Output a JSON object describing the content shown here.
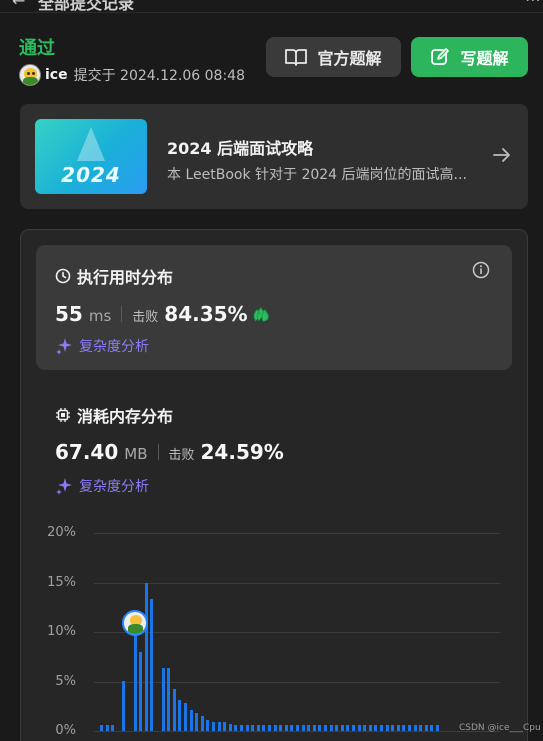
{
  "header": {
    "title": "全部提交记录"
  },
  "submission": {
    "status": "通过",
    "status_color": "#2cbb5d",
    "username": "ice",
    "submitted_text": "提交于 2024.12.06 08:48"
  },
  "buttons": {
    "official_solution": "官方题解",
    "write_solution": "写题解"
  },
  "book": {
    "cover_text": "2024",
    "title": "2024 后端面试攻略",
    "description": "本 LeetBook 针对于 2024 后端岗位的面试高..."
  },
  "runtime": {
    "title": "执行用时分布",
    "value": "55",
    "unit": "ms",
    "beat_label": "击败",
    "percent": "84.35%",
    "complexity_link": "复杂度分析"
  },
  "memory": {
    "title": "消耗内存分布",
    "value": "67.40",
    "unit": "MB",
    "beat_label": "击败",
    "percent": "24.59%",
    "complexity_link": "复杂度分析"
  },
  "chart_data": {
    "type": "bar",
    "title": "",
    "xlabel": "",
    "ylabel": "",
    "ylim": [
      0,
      20
    ],
    "yticks": [
      "20%",
      "15%",
      "10%",
      "5%",
      "0%"
    ],
    "grid": true,
    "bar_color": "#1a76e8",
    "values": [
      0.6,
      0.6,
      0.6,
      0,
      5.1,
      0,
      9.8,
      8.0,
      15.0,
      13.3,
      0,
      6.4,
      6.4,
      4.2,
      3.1,
      2.8,
      2.1,
      1.8,
      1.5,
      1.1,
      0.9,
      0.9,
      0.9,
      0.7,
      0.6,
      0.6,
      0.6,
      0.6,
      0.6,
      0.6,
      0.6,
      0.6,
      0.6,
      0.6,
      0.6,
      0.6,
      0.6,
      0.6,
      0.6,
      0.6,
      0.6,
      0.6,
      0.6,
      0.6,
      0.6,
      0.6,
      0.6,
      0.6,
      0.6,
      0.6,
      0.6,
      0.6,
      0.6,
      0.6,
      0.6,
      0.6,
      0.6,
      0.6,
      0.6,
      0.6,
      0.6
    ],
    "highlight_index": 6
  },
  "watermark": "CSDN @ice___Cpu"
}
